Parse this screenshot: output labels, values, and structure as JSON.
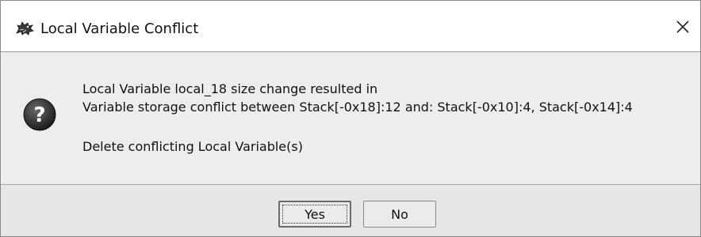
{
  "dialog": {
    "title": "Local Variable Conflict",
    "title_icon": "ghidra-dragon-icon",
    "close_icon": "close-icon",
    "message_icon": "question-icon",
    "message_line1": "Local Variable local_18 size change resulted in",
    "message_line2": "Variable storage conflict between Stack[-0x18]:12 and: Stack[-0x10]:4, Stack[-0x14]:4",
    "message_line3": "Delete conflicting Local Variable(s)",
    "buttons": {
      "yes_label": "Yes",
      "no_label": "No"
    }
  }
}
